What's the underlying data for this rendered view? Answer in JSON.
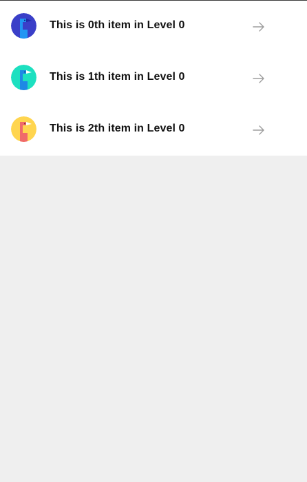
{
  "list": {
    "items": [
      {
        "label": "This is 0th item in Level 0",
        "avatar_bg": "#3a3fc8",
        "avatar_fg": "#2196f3",
        "avatar_beak": "#1f2aa8",
        "icon": "bird-avatar-icon"
      },
      {
        "label": "This is 1th item in Level 0",
        "avatar_bg": "#1de0c0",
        "avatar_fg": "#1e88e5",
        "avatar_beak": "#ffffff",
        "icon": "bird-avatar-icon"
      },
      {
        "label": "This is 2th item in Level 0",
        "avatar_bg": "#ffd54f",
        "avatar_fg": "#f06a6a",
        "avatar_beak": "#ffffff",
        "icon": "bird-avatar-icon"
      }
    ],
    "arrow_icon": "arrow-right-icon",
    "arrow_color": "#9e9e9e"
  },
  "colors": {
    "background": "#efefef",
    "list_background": "#ffffff",
    "text": "#111111"
  }
}
